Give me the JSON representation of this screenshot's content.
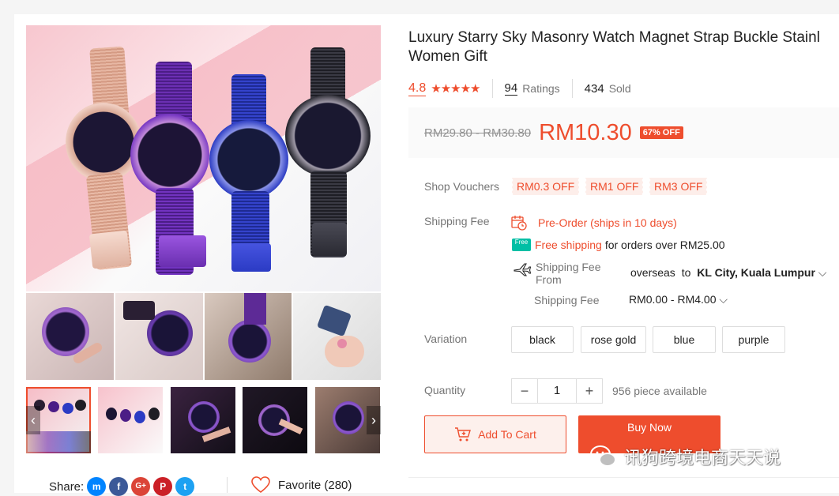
{
  "product": {
    "title_line1": "Luxury Starry Sky Masonry Watch Magnet Strap Buckle Stainl",
    "title_line2": "Women Gift",
    "rating": "4.8",
    "stars": "★★★★★",
    "ratings_count": "94",
    "ratings_label": "Ratings",
    "sold_count": "434",
    "sold_label": "Sold"
  },
  "price": {
    "original": "RM29.80 - RM30.80",
    "current": "RM10.30",
    "discount": "67% OFF"
  },
  "vouchers": {
    "label": "Shop Vouchers",
    "items": [
      "RM0.3 OFF",
      "RM1 OFF",
      "RM3 OFF"
    ]
  },
  "shipping": {
    "label": "Shipping Fee",
    "preorder": "Pre-Order (ships in 10 days)",
    "free_badge": "Free",
    "free_shipping": "Free shipping",
    "free_condition": "for orders over RM25.00",
    "from_label_1": "Shipping Fee",
    "from_label_2": "From",
    "from_value": "overseas",
    "to_word": "to",
    "destination": "KL City, Kuala Lumpur",
    "fee_label": "Shipping Fee",
    "fee_value": "RM0.00 - RM4.00"
  },
  "variation": {
    "label": "Variation",
    "options": [
      "black",
      "rose gold",
      "blue",
      "purple"
    ]
  },
  "quantity": {
    "label": "Quantity",
    "minus": "−",
    "value": "1",
    "plus": "+",
    "available": "956 piece available"
  },
  "actions": {
    "add_to_cart": "Add To Cart",
    "buy_now": "Buy Now"
  },
  "social": {
    "share_label": "Share:",
    "favorite_label": "Favorite (280)"
  },
  "watermark": {
    "text": "讯狗跨境电商天天说"
  },
  "icons": {
    "prev": "‹",
    "next": "›",
    "chevron": "⌵"
  },
  "colors": {
    "accent": "#ee4d2d",
    "rose_gold": "#d9a48c",
    "purple": "#6a2fb0",
    "blue": "#2b3bc4",
    "black": "#2a2a32"
  }
}
